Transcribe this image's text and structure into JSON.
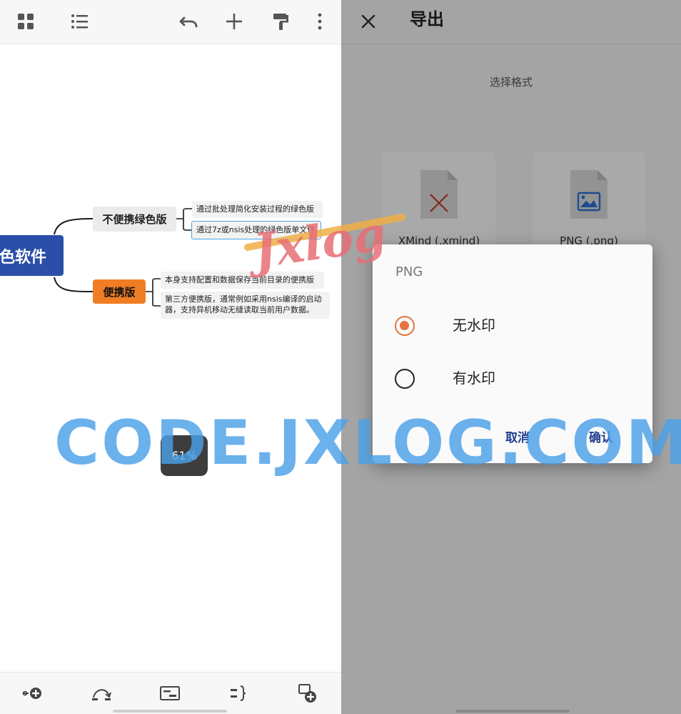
{
  "left_pane": {
    "mindmap": {
      "root": "色软件",
      "branches": [
        {
          "label": "不便携绿色版",
          "children": [
            "通过批处理简化安装过程的绿色版",
            "通过7z或nsis处理的绿色版单文件"
          ]
        },
        {
          "label": "便携版",
          "children": [
            "本身支持配置和数据保存当前目录的便携版",
            "第三方便携版，通常例如采用nsis编译的启动器，支持异机移动无缝读取当前用户数据。"
          ]
        }
      ]
    },
    "zoom_label": "61%"
  },
  "right_pane": {
    "header": {
      "title": "导出"
    },
    "format_section_label": "选择格式",
    "formats": [
      {
        "name": "XMind (.xmind)",
        "icon": "xmind-file-icon"
      },
      {
        "name": "PNG (.png)",
        "icon": "png-file-icon"
      }
    ],
    "dialog": {
      "title": "PNG",
      "options": [
        {
          "label": "无水印",
          "selected": true
        },
        {
          "label": "有水印",
          "selected": false
        }
      ],
      "cancel_label": "取消",
      "confirm_label": "确认"
    }
  },
  "watermarks": {
    "logo_text": "Jxlog",
    "site_text": "CODE.JXLOG.COM"
  },
  "colors": {
    "accent": "#e3743c",
    "root_node": "#2b4fa8",
    "portable_node": "#f07d24",
    "selected_border": "#4aa6e8",
    "dialog_button": "#1f3f8f"
  }
}
